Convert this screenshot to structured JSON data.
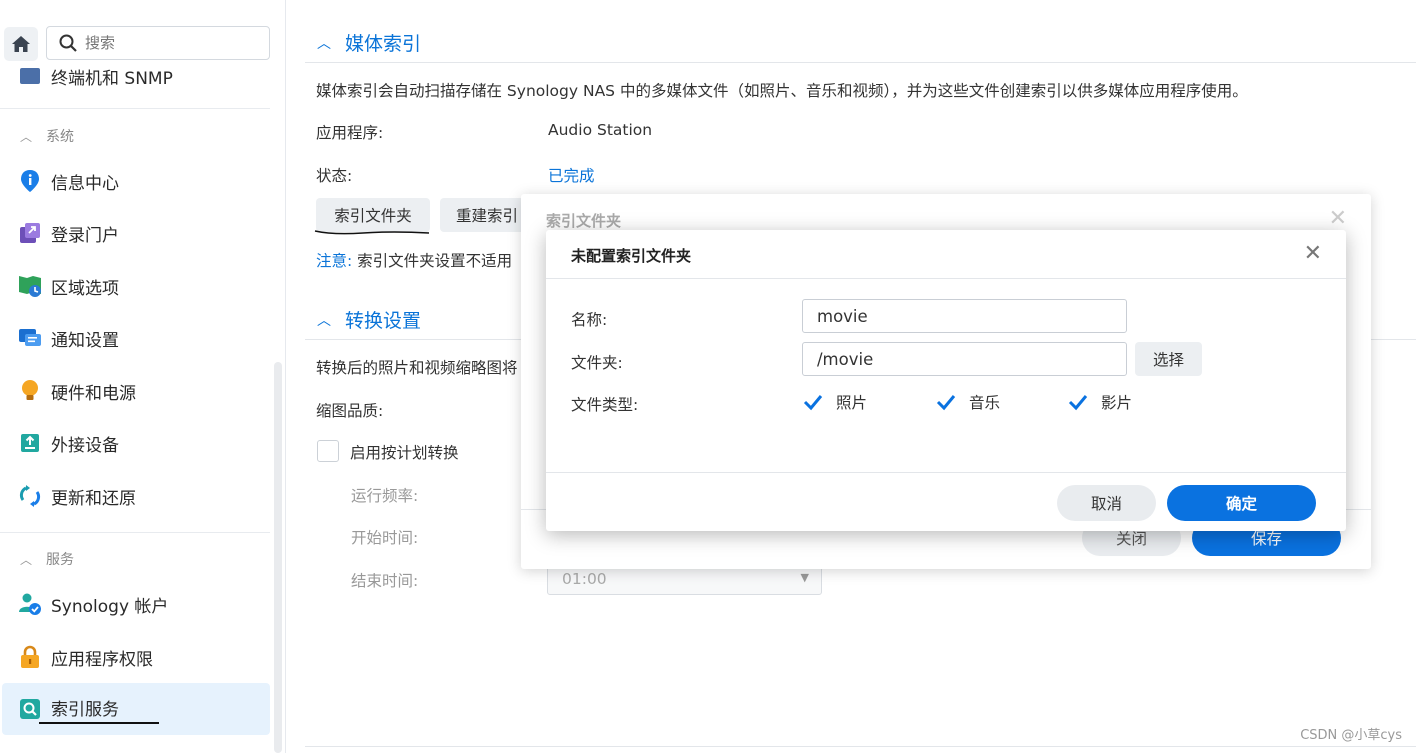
{
  "sidebar": {
    "search_placeholder": "搜索",
    "partial_item": "终端机和 SNMP",
    "group_system": "系统",
    "group_services": "服务",
    "items": [
      {
        "label": "信息中心",
        "icon": "info-icon"
      },
      {
        "label": "登录门户",
        "icon": "portal-icon"
      },
      {
        "label": "区域选项",
        "icon": "region-icon"
      },
      {
        "label": "通知设置",
        "icon": "notification-icon"
      },
      {
        "label": "硬件和电源",
        "icon": "bulb-icon"
      },
      {
        "label": "外接设备",
        "icon": "external-device-icon"
      },
      {
        "label": "更新和还原",
        "icon": "update-icon"
      }
    ],
    "service_items": [
      {
        "label": "Synology 帐户",
        "icon": "account-icon"
      },
      {
        "label": "应用程序权限",
        "icon": "lock-icon"
      },
      {
        "label": "索引服务",
        "icon": "index-service-icon"
      }
    ]
  },
  "media_index": {
    "title": "媒体索引",
    "description": "媒体索引会自动扫描存储在 Synology NAS 中的多媒体文件（如照片、音乐和视频），并为这些文件创建索引以供多媒体应用程序使用。",
    "app_label": "应用程序:",
    "app_value": "Audio Station",
    "status_label": "状态:",
    "status_value": "已完成",
    "index_folder_button": "索引文件夹",
    "reindex_button": "重建索引",
    "note_prefix": "注意:",
    "note_text": "索引文件夹设置不适用"
  },
  "conversion": {
    "title": "转换设置",
    "description": "转换后的照片和视频缩略图将",
    "thumb_quality_label": "缩图品质:",
    "schedule_checkbox": "启用按计划转换",
    "frequency_label": "运行频率:",
    "start_label": "开始时间:",
    "end_label": "结束时间:",
    "end_value": "01:00"
  },
  "back_dialog": {
    "title": "索引文件夹",
    "close_button": "关闭",
    "save_button": "保存"
  },
  "dialog": {
    "title": "未配置索引文件夹",
    "name_label": "名称:",
    "name_value": "movie",
    "folder_label": "文件夹:",
    "folder_value": "/movie",
    "select_button": "选择",
    "filetype_label": "文件类型:",
    "types": [
      {
        "label": "照片",
        "checked": true
      },
      {
        "label": "音乐",
        "checked": true
      },
      {
        "label": "影片",
        "checked": true
      }
    ],
    "cancel_button": "取消",
    "ok_button": "确定"
  },
  "watermark": "CSDN @小草cys",
  "colors": {
    "accent": "#0b74d8",
    "active_bg": "#e6f2fd"
  }
}
